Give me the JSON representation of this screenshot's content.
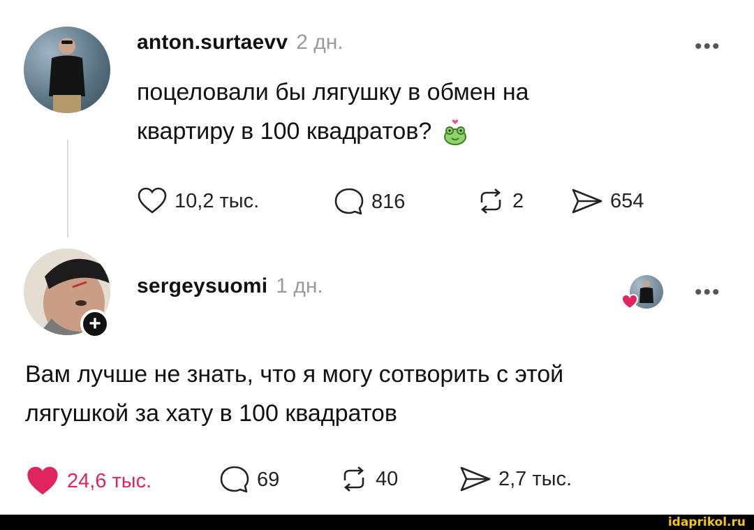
{
  "post": {
    "username": "anton.surtaevv",
    "time": "2 дн.",
    "text_line1": "поцеловали бы лягушку в обмен на",
    "text_line2": "квартиру в 100 квадратов?",
    "emoji_icon": "frog-with-heart-icon",
    "more": "•••",
    "likes": "10,2 тыс.",
    "comments": "816",
    "reposts": "2",
    "shares": "654"
  },
  "reply": {
    "username": "sergeysuomi",
    "time": "1 дн.",
    "text_line1": "Вам лучше не знать, что я могу сотворить с этой",
    "text_line2": "лягушкой за хату в 100 квадратов",
    "more": "•••",
    "follow_badge": "+",
    "likes": "24,6 тыс.",
    "comments": "69",
    "reposts": "40",
    "shares": "2,7 тыс.",
    "liked_by_author": true
  },
  "colors": {
    "like_red": "#e0245e",
    "muted": "#9a9a9a",
    "watermark": "#f0c419"
  },
  "watermark": "idaprikol.ru"
}
